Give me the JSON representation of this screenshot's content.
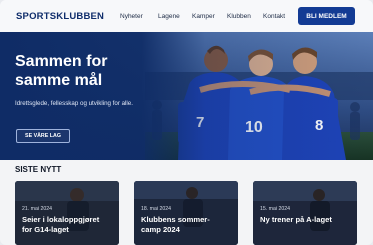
{
  "header": {
    "logo": "SPORTSKLUBBEN",
    "nav": [
      "Nyheter",
      "Lagene",
      "Kamper",
      "Klubben",
      "Kontakt"
    ],
    "cta": "BLI MEDLEM"
  },
  "hero": {
    "title": "Sammen for samme mål",
    "subtitle": "Idrettsglede, fellesskap og utvikling for alle.",
    "button": "SE VÅRE LAG",
    "jersey_numbers": [
      "7",
      "10",
      "8"
    ]
  },
  "news": {
    "heading": "SISTE NYTT",
    "cards": [
      {
        "date": "21. mai 2024",
        "title": "Seier i lokaloppgjøret for G14-laget"
      },
      {
        "date": "18. mai 2024",
        "title": "Klubbens sommer-camp 2024"
      },
      {
        "date": "15. mai 2024",
        "title": "Ny trener på A-laget"
      }
    ]
  },
  "colors": {
    "brand": "#0f2d6b",
    "accent": "#133b94",
    "hero_bg": "#0f2c66"
  }
}
